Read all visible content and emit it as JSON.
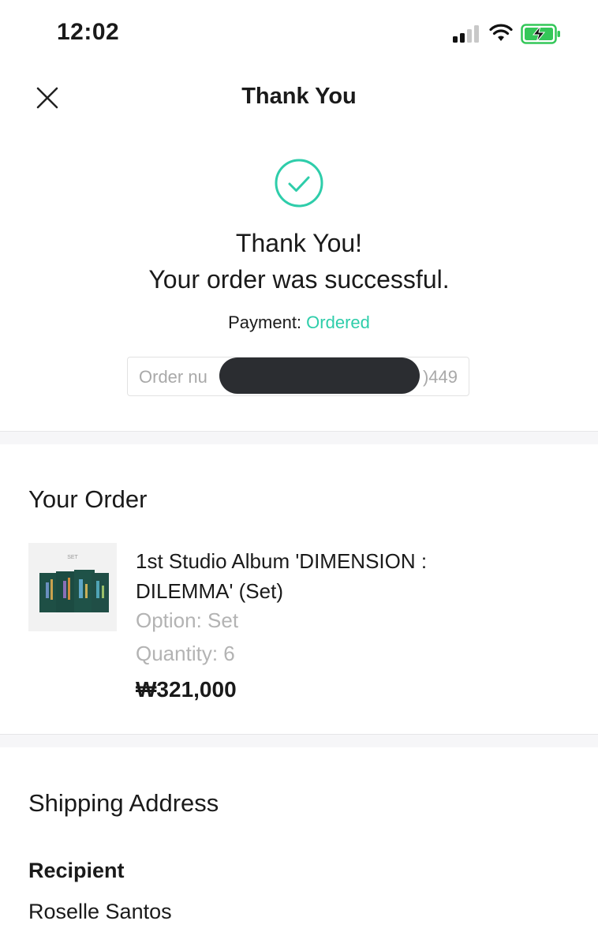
{
  "status_bar": {
    "time": "12:02",
    "icons": [
      "signal-icon",
      "wifi-icon",
      "battery-charging-icon"
    ]
  },
  "nav": {
    "title": "Thank You",
    "close_icon": "close-icon"
  },
  "success": {
    "icon": "check-circle-icon",
    "heading": "Thank You!",
    "message": "Your order was successful.",
    "payment_label": "Payment:",
    "payment_status": "Ordered",
    "order_number_prefix": "Order nu",
    "order_number_suffix": ")449"
  },
  "order": {
    "section_title": "Your Order",
    "thumb_label": "SET",
    "product_name": "1st Studio Album 'DIMENSION : DILEMMA' (Set)",
    "option": "Option: Set",
    "quantity": "Quantity: 6",
    "price": "₩321,000"
  },
  "shipping": {
    "section_title": "Shipping Address",
    "recipient_label": "Recipient",
    "recipient_name": "Roselle Santos"
  },
  "colors": {
    "accent": "#2ecdaa",
    "muted_text": "#b3b3b3",
    "battery_green": "#34c759",
    "redaction": "#2b2d31"
  }
}
